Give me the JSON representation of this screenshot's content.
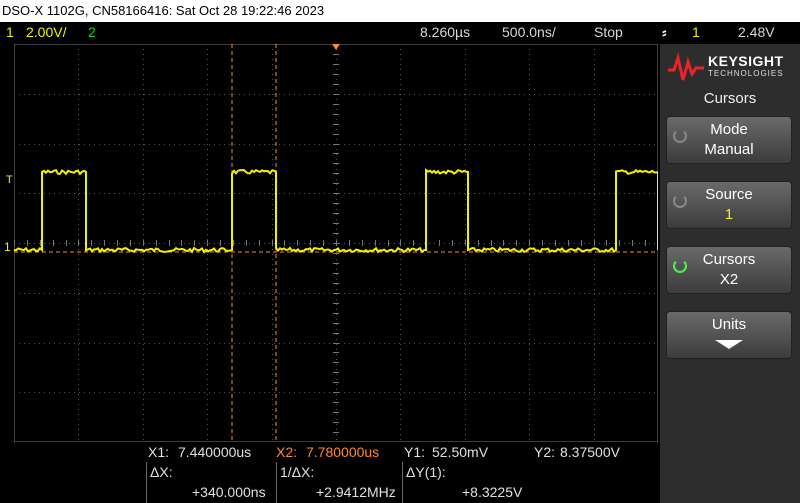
{
  "title": "DSO-X 1102G, CN58166416: Sat Oct 28 19:22:46 2023",
  "status": {
    "ch1_label": "1",
    "ch1_scale": "2.00V/",
    "ch2_label": "2",
    "time_delay": "8.260µs",
    "time_scale": "500.0ns/",
    "run_state": "Stop",
    "trigger_icon": "trigger-edge-rising-icon",
    "trigger_source": "1",
    "trigger_level": "2.48V"
  },
  "scope": {
    "ch1_marker": "1",
    "trigger_marker": "T",
    "colors": {
      "ch1": "#f2f200",
      "cursor": "#ff8a2a",
      "grid": "#6b6b6b"
    }
  },
  "brand": {
    "name": "KEYSIGHT",
    "sub": "TECHNOLOGIES"
  },
  "menu": {
    "title": "Cursors",
    "keys": [
      {
        "label": "Mode",
        "value": "Manual"
      },
      {
        "label": "Source",
        "value": "1"
      },
      {
        "label": "Cursors",
        "value": "X2"
      },
      {
        "label": "Units",
        "value": ""
      }
    ]
  },
  "measurements": {
    "x1_label": "X1:",
    "x1_value": "7.440000us",
    "x2_label": "X2:",
    "x2_value": "7.780000us",
    "y1_label": "Y1:",
    "y1_value": "52.50mV",
    "y2_label": "Y2:",
    "y2_value": "8.37500V",
    "dx_label": "ΔX:",
    "dx_value": "+340.000ns",
    "inv_dx_label": "1/ΔX:",
    "inv_dx_value": "+2.9412MHz",
    "dy_label": "ΔY(1):",
    "dy_value": "+8.3225V"
  }
}
